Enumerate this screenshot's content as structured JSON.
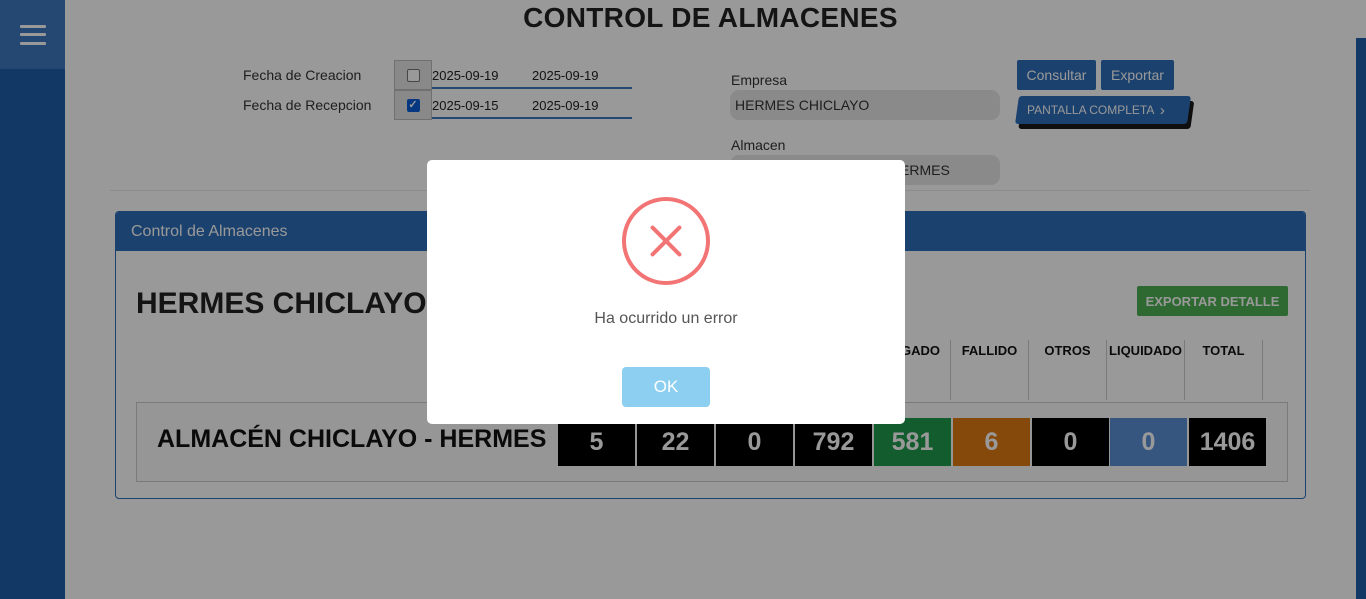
{
  "page": {
    "title": "CONTROL DE ALMACENES"
  },
  "filters": {
    "fecha_creacion": {
      "label": "Fecha de Creacion",
      "checked": false,
      "desde": "2025-09-19",
      "hasta": "2025-09-19"
    },
    "fecha_recepcion": {
      "label": "Fecha de Recepcion",
      "checked": true,
      "desde": "2025-09-15",
      "hasta": "2025-09-19"
    },
    "empresa": {
      "label": "Empresa",
      "value": "HERMES CHICLAYO"
    },
    "almacen": {
      "label": "Almacen",
      "value": "ALMACÉN CHICLAYO - HERMES",
      "visible_value": "ERMES"
    }
  },
  "actions": {
    "consultar": "Consultar",
    "exportar": "Exportar",
    "pantalla_completa": "PANTALLA COMPLETA",
    "pantalla_completa_icon": "chevron-right-icon"
  },
  "card": {
    "title": "Control de Almacenes",
    "company": "HERMES CHICLAYO",
    "export_detail": "EXPORTAR DETALLE",
    "columns": [
      "REGADO",
      "FALLIDO",
      "OTROS",
      "LIQUIDADO",
      "TOTAL"
    ],
    "row": {
      "label": "ALMACÉN CHICLAYO - HERMES",
      "values": [
        "5",
        "22",
        "0",
        "792",
        "581",
        "6",
        "0",
        "0",
        "1406"
      ],
      "colors": [
        "#000000",
        "#000000",
        "#000000",
        "#000000",
        "#1e9a4b",
        "#e07a14",
        "#000000",
        "#5b8fd6",
        "#000000"
      ]
    }
  },
  "modal": {
    "icon": "error-x-icon",
    "message": "Ha ocurrido un error",
    "ok": "OK"
  }
}
